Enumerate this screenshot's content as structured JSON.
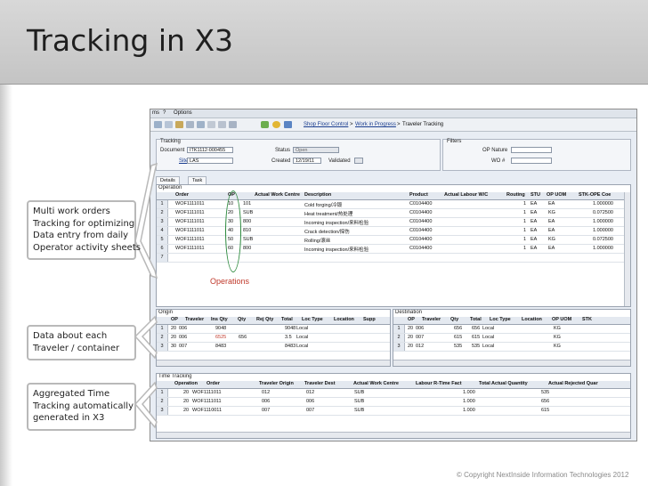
{
  "slide": {
    "title": "Tracking in X3",
    "operations_label": "Operations",
    "copyright": "© Copyright NextInside Information Technologies 2012"
  },
  "callouts": [
    {
      "lines": [
        "Multi work orders",
        "Tracking for optimizing",
        "Data  entry from daily",
        "Operator activity sheets"
      ]
    },
    {
      "lines": [
        "Data about each",
        "Traveler / container"
      ]
    },
    {
      "lines": [
        "Aggregated Time",
        "Tracking automatically",
        "generated in X3"
      ]
    }
  ],
  "app": {
    "menu": [
      "ms",
      "?",
      "Options"
    ],
    "breadcrumb": [
      "Shop Floor Control",
      ">",
      "Work in Progress",
      ">",
      "Traveler Tracking"
    ],
    "tracking": {
      "title": "Tracking",
      "document_label": "Document",
      "document_value": "ITK1112-000455",
      "site_label": "Site",
      "site_value": "LAS",
      "status_label": "Status",
      "status_value": "Open",
      "created_label": "Created",
      "created_value": "12/19/11",
      "validated_label": "Validated"
    },
    "filters": {
      "title": "Filters",
      "op_nature_label": "OP Nature",
      "wo_label": "WO #"
    },
    "tabs": [
      "Details",
      "Task"
    ],
    "operation": {
      "title": "Operation",
      "headers": [
        "Order",
        "OP",
        "Actual Work Centre",
        "Description",
        "Product",
        "Actual Labour W/C",
        "Routing",
        "STU",
        "OP UOM",
        "STK-OPE Coe"
      ],
      "rows": [
        {
          "n": "1",
          "order": "WOF1111011",
          "op": "10",
          "wc": "101",
          "desc": "Cold forging/冷锻",
          "product": "C0104400",
          "routing": "1",
          "stu": "EA",
          "opuom": "EA",
          "coef": "1.000000"
        },
        {
          "n": "2",
          "order": "WOF1111011",
          "op": "20",
          "wc": "SUB",
          "desc": "Heat treatment/热处理",
          "product": "C0104400",
          "routing": "1",
          "stu": "EA",
          "opuom": "KG",
          "coef": "0.072500"
        },
        {
          "n": "3",
          "order": "WOF1111011",
          "op": "30",
          "wc": "800",
          "desc": "Incoming inspection/来料检验",
          "product": "C0104400",
          "routing": "1",
          "stu": "EA",
          "opuom": "EA",
          "coef": "1.000000"
        },
        {
          "n": "4",
          "order": "WOF1111011",
          "op": "40",
          "wc": "810",
          "desc": "Crack detection/探伤",
          "product": "C0104400",
          "routing": "1",
          "stu": "EA",
          "opuom": "EA",
          "coef": "1.000000"
        },
        {
          "n": "5",
          "order": "WOF1111011",
          "op": "50",
          "wc": "SUB",
          "desc": "Rolling/滚丝",
          "product": "C0104400",
          "routing": "1",
          "stu": "EA",
          "opuom": "KG",
          "coef": "0.072500"
        },
        {
          "n": "6",
          "order": "WOF1111011",
          "op": "60",
          "wc": "800",
          "desc": "Incoming inspection/来料检验",
          "product": "C0104400",
          "routing": "1",
          "stu": "EA",
          "opuom": "EA",
          "coef": "1.000000"
        },
        {
          "n": "7"
        }
      ]
    },
    "origin": {
      "title": "Origin",
      "headers": [
        "OP",
        "Traveler",
        "Ins Qty",
        "Qty",
        "Rej Qty",
        "Total",
        "Loc Type",
        "Location",
        "Supp"
      ],
      "rows": [
        {
          "n": "1",
          "op": "20",
          "traveler": "006",
          "ins": "9048",
          "qty": "",
          "rej": "",
          "total": "9048",
          "loctype": "Local"
        },
        {
          "n": "2",
          "op": "20",
          "traveler": "006",
          "ins": "6525",
          "qty": "656",
          "rej": "",
          "total": "3.5",
          "loctype": "Local"
        },
        {
          "n": "3",
          "op": "30",
          "traveler": "007",
          "ins": "8483",
          "qty": "",
          "rej": "",
          "total": "8483",
          "loctype": "Local"
        }
      ]
    },
    "destination": {
      "title": "Destination",
      "headers": [
        "OP",
        "Traveler",
        "Qty",
        "Total",
        "Loc Type",
        "Location",
        "OP UOM",
        "STK"
      ],
      "rows": [
        {
          "n": "1",
          "op": "20",
          "traveler": "006",
          "qty": "656",
          "total": "656",
          "loctype": "Local",
          "uom": "KG"
        },
        {
          "n": "2",
          "op": "20",
          "traveler": "007",
          "qty": "615",
          "total": "615",
          "loctype": "Local",
          "uom": "KG"
        },
        {
          "n": "3",
          "op": "20",
          "traveler": "012",
          "qty": "535",
          "total": "535",
          "loctype": "Local",
          "uom": "KG"
        }
      ]
    },
    "time_tracking": {
      "title": "Time Tracking",
      "headers": [
        "Operation",
        "Order",
        "Traveler Origin",
        "Traveler Dest",
        "Actual Work Centre",
        "Labour R-Time Fact",
        "Total Actual Quantity",
        "Actual Rejected Quar"
      ],
      "rows": [
        {
          "n": "1",
          "op": "20",
          "order": "WOF1111011",
          "orig": "012",
          "dest": "012",
          "wc": "SUB",
          "fact": "1.000",
          "qty": "535"
        },
        {
          "n": "2",
          "op": "20",
          "order": "WOF1111011",
          "orig": "006",
          "dest": "006",
          "wc": "SUB",
          "fact": "1.000",
          "qty": "656"
        },
        {
          "n": "3",
          "op": "20",
          "order": "WOF1110011",
          "orig": "007",
          "dest": "007",
          "wc": "SUB",
          "fact": "1.000",
          "qty": "615"
        }
      ]
    }
  }
}
